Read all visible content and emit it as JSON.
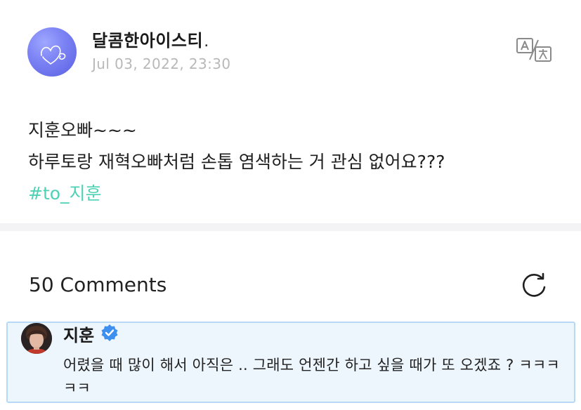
{
  "post": {
    "author": "달콤한아이스티",
    "author_suffix": ".",
    "date": "Jul 03, 2022, 23:30",
    "lines": [
      "지훈오빠~~~",
      "하루토랑 재혁오빠처럼 손톱 염색하는 거 관심 없어요???"
    ],
    "hashtag": "#to_지훈",
    "translate_icon": "translate-icon"
  },
  "comments": {
    "count_label": "50 Comments",
    "refresh_icon": "refresh-icon",
    "items": [
      {
        "author": "지훈",
        "verified": true,
        "text": "어렸을 때 많이 해서 아직은 .. 그래도 언젠간 하고 싶을 때가 또 오겠죠 ? ㅋㅋㅋㅋㅋ"
      }
    ]
  },
  "colors": {
    "hashtag": "#4fd1b5",
    "date": "#b8b8b8",
    "comment_bg": "#eef6fd",
    "comment_border": "#b7d9f5",
    "verified": "#3d8ff0",
    "avatar": "#7d84f5"
  }
}
